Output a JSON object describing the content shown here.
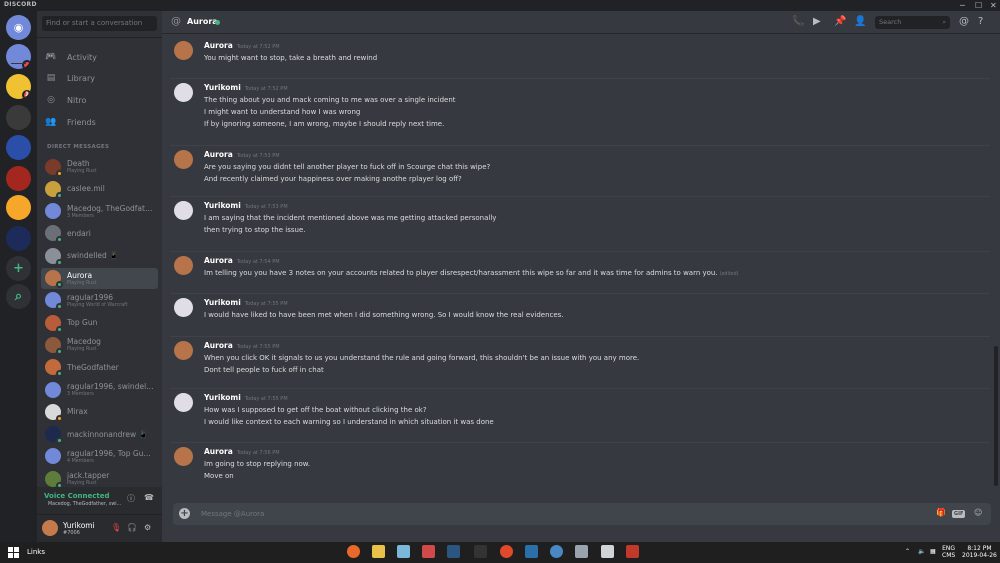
{
  "app": {
    "title": "DISCORD",
    "min": "─",
    "max": "☐",
    "close": "✕"
  },
  "servers": [
    {
      "name": "home",
      "icon": "discord-icon",
      "color": "#7289da"
    },
    {
      "name": "server-1",
      "color": "#7289da",
      "badge": ""
    },
    {
      "name": "server-2",
      "color": "#f0c233",
      "badge": "1"
    },
    {
      "name": "server-3",
      "color": "#3a3a3a"
    },
    {
      "name": "server-4",
      "color": "#2b4fa8"
    },
    {
      "name": "server-5",
      "color": "#a3271f"
    },
    {
      "name": "server-6",
      "color": "#f6a72a"
    },
    {
      "name": "server-7",
      "color": "#1c2b5a"
    },
    {
      "name": "add-server",
      "glyph": "+",
      "color": "#2f3136"
    },
    {
      "name": "explore-servers",
      "glyph": "⌕",
      "color": "#2f3136"
    }
  ],
  "sidebar": {
    "search_placeholder": "Find or start a conversation",
    "nav": [
      {
        "label": "Activity",
        "icon": "gamepad-icon",
        "glyph": "🎮"
      },
      {
        "label": "Library",
        "icon": "library-icon",
        "glyph": "▤"
      },
      {
        "label": "Nitro",
        "icon": "nitro-icon",
        "glyph": "◎"
      },
      {
        "label": "Friends",
        "icon": "friends-icon",
        "glyph": "👥"
      }
    ],
    "dm_header": "DIRECT MESSAGES",
    "dms": [
      {
        "name": "Death",
        "sub": "Playing Rust",
        "color": "#7a3b2a",
        "status": "#faa61a"
      },
      {
        "name": "caslee.mil",
        "sub": "",
        "color": "#c9a13c",
        "status": "#43b581"
      },
      {
        "name": "Macedog, TheGodfathe...",
        "sub": "3 Members",
        "color": "#7289da",
        "status": ""
      },
      {
        "name": "endari",
        "sub": "",
        "color": "#6a6f78",
        "status": "#43b581"
      },
      {
        "name": "swindelled 📱",
        "sub": "",
        "color": "#8a9099",
        "status": "#43b581"
      },
      {
        "name": "Aurora",
        "sub": "Playing Rust",
        "color": "#b7744a",
        "status": "#43b581",
        "active": true
      },
      {
        "name": "ragular1996",
        "sub": "Playing World of Warcraft",
        "color": "#7289da",
        "status": "#43b581"
      },
      {
        "name": "Top Gun",
        "sub": "",
        "color": "#b85c3a",
        "status": "#43b581"
      },
      {
        "name": "Macedog",
        "sub": "Playing Rust",
        "color": "#8b5a3c",
        "status": "#43b581"
      },
      {
        "name": "TheGodfather",
        "sub": "",
        "color": "#c36a3d",
        "status": "#43b581"
      },
      {
        "name": "ragular1996, swindelled",
        "sub": "3 Members",
        "color": "#7289da",
        "status": ""
      },
      {
        "name": "Mirax",
        "sub": "",
        "color": "#d9d9d9",
        "status": "#faa61a"
      },
      {
        "name": "mackinnonandrew 📱",
        "sub": "",
        "color": "#1d2a4d",
        "status": "#43b581"
      },
      {
        "name": "ragular1996, Top Gun, ...",
        "sub": "4 Members",
        "color": "#7289da",
        "status": ""
      },
      {
        "name": "jack.tapper",
        "sub": "Playing Rust",
        "color": "#5f7d3a",
        "status": "#43b581"
      }
    ],
    "voice": {
      "title": "Voice Connected",
      "channel": "Macedog, TheGodfather, swi..."
    },
    "user": {
      "name": "Yurikomi",
      "tag": "#7006"
    }
  },
  "chat": {
    "at": "@",
    "title": "Aurora",
    "search_placeholder": "Search",
    "composer_placeholder": "Message @Aurora",
    "gif": "GIF",
    "messages": [
      {
        "author": "Aurora",
        "time": "Today at 7:52 PM",
        "lines": [
          "You might want to stop, take a breath and rewind"
        ]
      },
      {
        "author": "Yurikomi",
        "time": "Today at 7:52 PM",
        "lines": [
          "The thing about you and mack coming to me was over a single incident",
          "I might want to understand how I was wrong",
          "If by ignoring someone, I am wrong, maybe I should reply next time."
        ]
      },
      {
        "author": "Aurora",
        "time": "Today at 7:53 PM",
        "lines": [
          "Are you saying you didnt tell another player to fuck off in Scourge chat this wipe?",
          "And recently claimed your happiness over making anothe rplayer log off?"
        ]
      },
      {
        "author": "Yurikomi",
        "time": "Today at 7:53 PM",
        "lines": [
          "I am saying that the incident mentioned above was me getting attacked personally",
          "then trying to stop the issue."
        ]
      },
      {
        "author": "Aurora",
        "time": "Today at 7:54 PM",
        "lines": [
          "Im telling you you have 3 notes on your accounts related to player disrespect/harassment this wipe so far and it was time for admins to warn you."
        ],
        "edited": "(edited)"
      },
      {
        "author": "Yurikomi",
        "time": "Today at 7:55 PM",
        "lines": [
          "I would have liked to have been met when I did something wrong. So I would know the real evidences."
        ]
      },
      {
        "author": "Aurora",
        "time": "Today at 7:55 PM",
        "lines": [
          "When you click OK it signals to us you understand the rule and going forward, this shouldn't be an issue with you any more.",
          "Dont tell people to fuck off in chat"
        ]
      },
      {
        "author": "Yurikomi",
        "time": "Today at 7:55 PM",
        "lines": [
          "How was I supposed to get off the boat without clicking the ok?",
          "I would like context to each warning so I understand in which situation it was done"
        ]
      },
      {
        "author": "Aurora",
        "time": "Today at 7:56 PM",
        "lines": [
          "Im going to stop replying now.",
          "Move on"
        ]
      }
    ]
  },
  "taskbar": {
    "links": "Links",
    "lang1": "ENG",
    "lang2": "CMS",
    "time": "8:12 PM",
    "date": "2019-04-26"
  }
}
